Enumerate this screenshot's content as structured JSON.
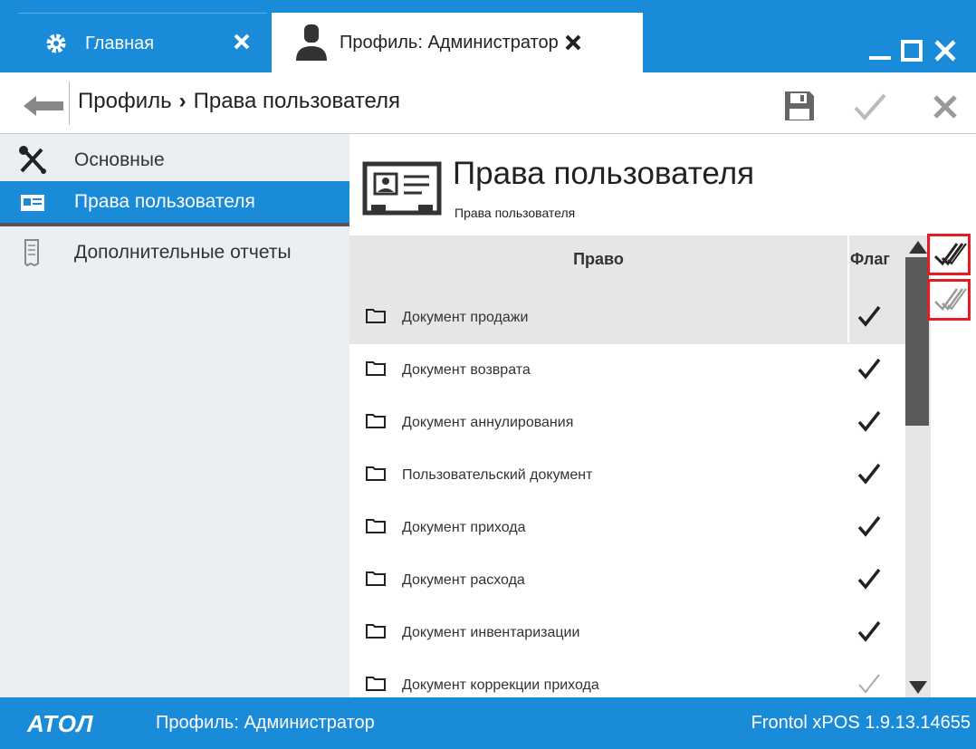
{
  "window": {
    "tabs": [
      {
        "label": "Главная",
        "icon": "gear-icon"
      },
      {
        "label": "Профиль: Администратор",
        "icon": "user-icon"
      }
    ],
    "controls": [
      "minimize",
      "maximize",
      "close"
    ]
  },
  "toolbar": {
    "breadcrumb_root": "Профиль",
    "breadcrumb_sep": "›",
    "breadcrumb_current": "Права пользователя"
  },
  "sidebar": {
    "items": [
      {
        "label": "Основные",
        "icon": "tools-icon",
        "active": false
      },
      {
        "label": "Права пользователя",
        "icon": "id-card-icon",
        "active": true
      },
      {
        "label": "Дополнительные отчеты",
        "icon": "report-icon",
        "active": false
      }
    ]
  },
  "content": {
    "title": "Права пользователя",
    "subtitle": "Права пользователя"
  },
  "grid": {
    "columns": [
      "Право",
      "Флаг"
    ],
    "rows": [
      {
        "name": "Документ продажи",
        "flag": true
      },
      {
        "name": "Документ возврата",
        "flag": true
      },
      {
        "name": "Документ аннулирования",
        "flag": true
      },
      {
        "name": "Пользовательский документ",
        "flag": true
      },
      {
        "name": "Документ прихода",
        "flag": true
      },
      {
        "name": "Документ расхода",
        "flag": true
      },
      {
        "name": "Документ инвентаризации",
        "flag": true
      },
      {
        "name": "Документ коррекции прихода",
        "flag": false
      }
    ]
  },
  "status": {
    "logo": "АТОЛ",
    "profile": "Профиль: Администратор",
    "version": "Frontol xPOS 1.9.13.14655"
  },
  "colors": {
    "accent": "#1a8bd8",
    "highlight_border": "#e41c23",
    "sidebar_bg": "#eceff1",
    "grid_bg": "#e6e6e6"
  }
}
